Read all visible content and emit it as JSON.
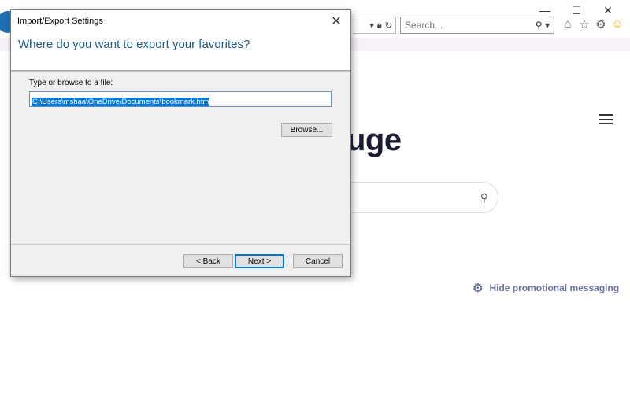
{
  "browser": {
    "search_placeholder": "Search...",
    "icons": [
      "home-icon",
      "favorites-star-icon",
      "settings-gear-icon",
      "smiley-feedback-icon"
    ],
    "window_controls": [
      "minimize-icon",
      "maximize-icon",
      "close-icon"
    ]
  },
  "page": {
    "title_fragment": "uge",
    "promo_text": "Hide promotional messaging"
  },
  "dialog": {
    "title": "Import/Export Settings",
    "heading": "Where do you want to export your favorites?",
    "field_label": "Type or browse to a file:",
    "path_value": "C:\\Users\\mshaa\\OneDrive\\Documents\\bookmark.htm",
    "browse_label": "Browse...",
    "back_label": "< Back",
    "next_label": "Next >",
    "cancel_label": "Cancel"
  },
  "colors": {
    "heading_blue": "#1e5a8a",
    "selection_blue": "#0078d7",
    "promo_purple": "#6b73a0"
  }
}
